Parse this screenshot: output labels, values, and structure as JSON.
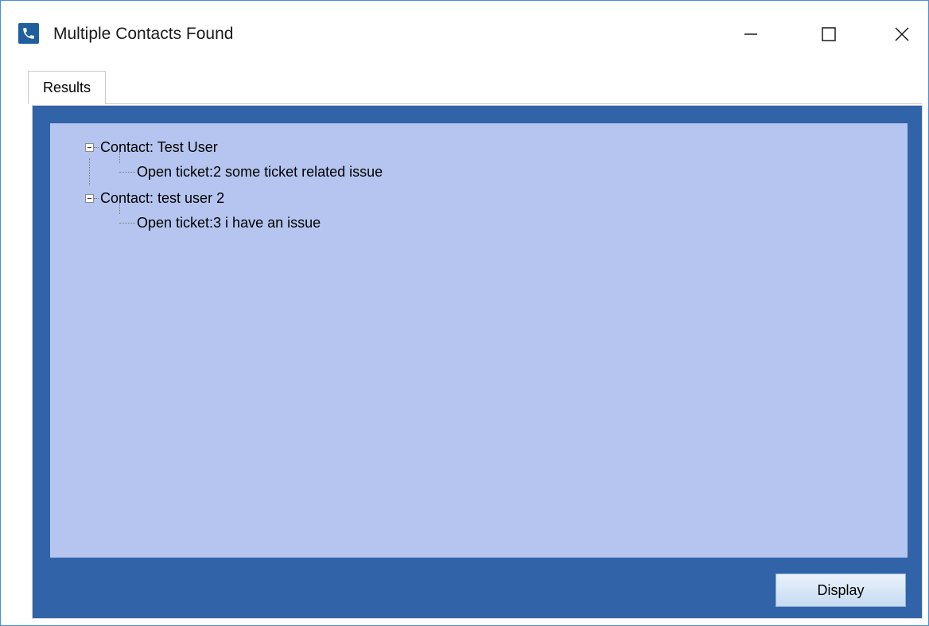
{
  "window": {
    "title": "Multiple Contacts Found",
    "icon": "phone-icon",
    "controls": [
      "minimize-icon",
      "maximize-icon",
      "close-icon"
    ]
  },
  "tabs": [
    {
      "label": "Results",
      "active": true
    }
  ],
  "tree": {
    "contacts": [
      {
        "label": "Contact: Test User",
        "expanded": true,
        "tickets": [
          {
            "label": "Open ticket:2 some ticket related issue"
          }
        ]
      },
      {
        "label": "Contact: test user 2",
        "expanded": true,
        "tickets": [
          {
            "label": "Open ticket:3 i have an issue"
          }
        ]
      }
    ]
  },
  "actions": {
    "display_label": "Display"
  },
  "colors": {
    "panel_background": "#3163a8",
    "tree_background": "#b5c5ef",
    "window_border": "#4a8fd6"
  }
}
